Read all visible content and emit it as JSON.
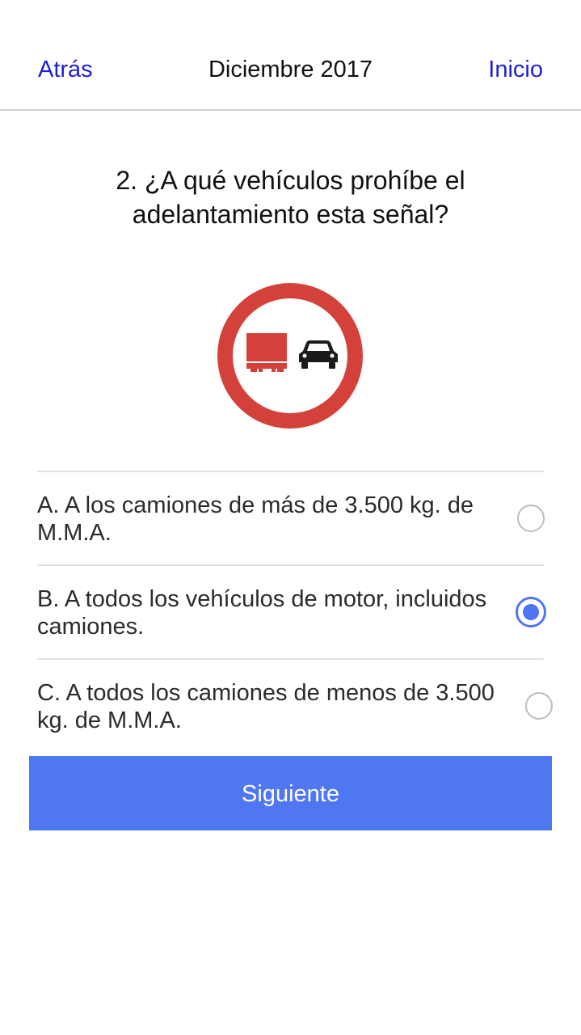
{
  "nav": {
    "back_label": "Atrás",
    "title": "Diciembre 2017",
    "home_label": "Inicio"
  },
  "question": {
    "text": "2. ¿A qué vehículos prohíbe el adelantamiento esta señal?"
  },
  "sign": {
    "icon": "no-overtaking-for-trucks-sign-icon",
    "ring_color": "#d3413a",
    "truck_color": "#d3413a",
    "car_color": "#1b1b1b"
  },
  "options": [
    {
      "text": "A. A los camiones de más de 3.500 kg. de M.M.A.",
      "selected": false
    },
    {
      "text": "B. A todos los vehículos de motor, incluidos camiones.",
      "selected": true
    },
    {
      "text": "C. A todos los camiones de menos de 3.500 kg. de M.M.A.",
      "selected": false
    }
  ],
  "next_button": {
    "label": "Siguiente",
    "color": "#5077f2"
  },
  "colors": {
    "link": "#1f1fd6",
    "accent": "#4e76f2"
  }
}
